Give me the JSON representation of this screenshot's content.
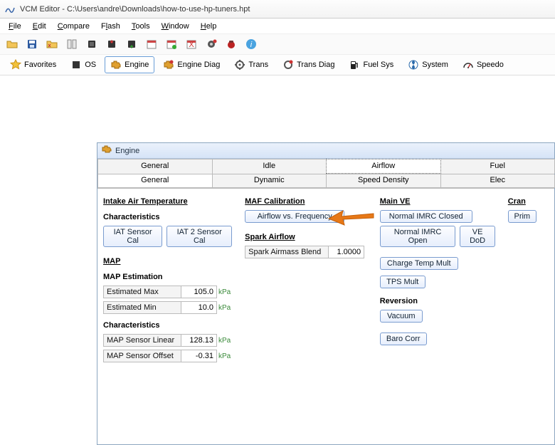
{
  "title": "VCM Editor - C:\\Users\\andre\\Downloads\\how-to-use-hp-tuners.hpt",
  "menu": {
    "file": "File",
    "edit": "Edit",
    "compare": "Compare",
    "flash": "Flash",
    "tools": "Tools",
    "window": "Window",
    "help": "Help"
  },
  "toolrow": {
    "favorites": "Favorites",
    "os": "OS",
    "engine": "Engine",
    "engine_diag": "Engine Diag",
    "trans": "Trans",
    "trans_diag": "Trans Diag",
    "fuel_sys": "Fuel Sys",
    "system": "System",
    "speedo": "Speedo"
  },
  "panel": {
    "title": "Engine"
  },
  "tabs1": {
    "general": "General",
    "idle": "Idle",
    "airflow": "Airflow",
    "fuel": "Fuel"
  },
  "tabs2": {
    "general": "General",
    "dynamic": "Dynamic",
    "speed_density": "Speed Density",
    "elec": "Elec"
  },
  "col1": {
    "s_iat": "Intake Air Temperature",
    "s_char": "Characteristics",
    "iat_cal": "IAT Sensor Cal",
    "iat2_cal": "IAT 2 Sensor Cal",
    "s_map": "MAP",
    "s_mapest": "MAP Estimation",
    "est_max_l": "Estimated Max",
    "est_max_v": "105.0",
    "est_max_u": "kPa",
    "est_min_l": "Estimated Min",
    "est_min_v": "10.0",
    "est_min_u": "kPa",
    "s_char2": "Characteristics",
    "lin_l": "MAP Sensor Linear",
    "lin_v": "128.13",
    "lin_u": "kPa",
    "off_l": "MAP Sensor Offset",
    "off_v": "-0.31",
    "off_u": "kPa"
  },
  "col2": {
    "s_maf": "MAF Calibration",
    "avf": "Airflow vs. Frequency",
    "s_spark": "Spark Airflow",
    "sab_l": "Spark Airmass Blend",
    "sab_v": "1.0000"
  },
  "col3": {
    "s_ve": "Main VE",
    "nic": "Normal IMRC Closed",
    "nio": "Normal IMRC Open",
    "vedod": "VE DoD",
    "ctm": "Charge Temp Mult",
    "tps": "TPS Mult",
    "s_rev": "Reversion",
    "vac": "Vacuum",
    "baro": "Baro Corr"
  },
  "col4": {
    "s_cran": "Cran",
    "prim": "Prim"
  }
}
